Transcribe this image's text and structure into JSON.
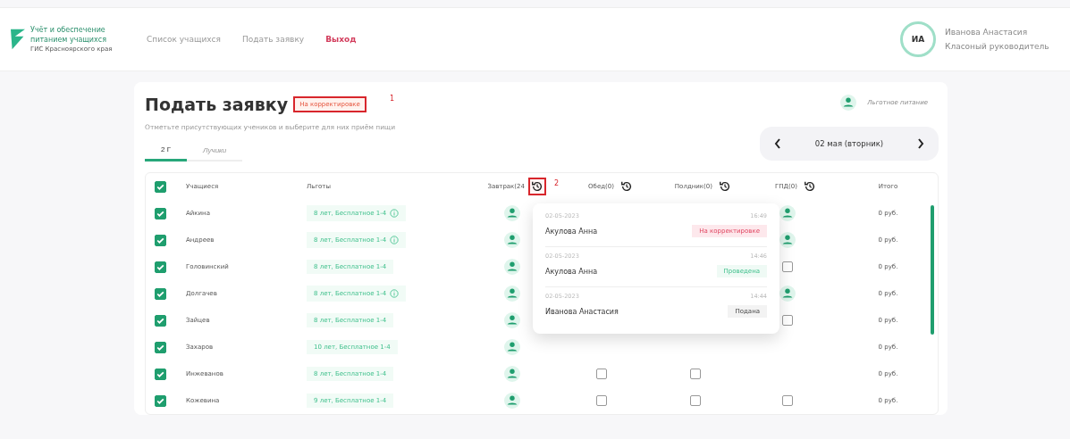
{
  "header": {
    "logo_lines": [
      "Учёт и обеспечение",
      "питанием учащихся",
      "ГИС Красноярского края"
    ],
    "nav": [
      {
        "label": "Список учащихся",
        "kind": "link"
      },
      {
        "label": "Подать заявку",
        "kind": "link"
      },
      {
        "label": "Выход",
        "kind": "logout"
      }
    ],
    "user": {
      "initials": "ИА",
      "name": "Иванова Анастасия",
      "role": "Класоный руководитель"
    }
  },
  "page": {
    "title": "Подать заявку",
    "badge": {
      "text": "На корректировке",
      "highlighted": true,
      "marker": "1"
    },
    "subtitle": "Отметьте присутствующих учеников и выберите для них приём пищи",
    "legend": "Льготное питание",
    "tabs": [
      {
        "label": "2 Г",
        "selected": true
      },
      {
        "label": "Лучики",
        "selected": false
      }
    ],
    "date": "02 мая (вторник)"
  },
  "table": {
    "all_checked": true,
    "columns": [
      {
        "label": "Учащиеся",
        "kind": "text"
      },
      {
        "label": "Льготы",
        "kind": "text"
      },
      {
        "label": "Завтрак(24",
        "kind": "meal",
        "highlighted": true,
        "marker": "2"
      },
      {
        "label": "Обед(0)",
        "kind": "meal",
        "highlighted": false
      },
      {
        "label": "Полдник(0)",
        "kind": "meal",
        "highlighted": false
      },
      {
        "label": "ГПД(0)",
        "kind": "meal",
        "highlighted": false
      },
      {
        "label": "Итого",
        "kind": "text"
      }
    ],
    "rows": [
      {
        "name": "Айкина",
        "checked": true,
        "benefit": "8 лет, Бесплатное 1-4",
        "info": true,
        "breakfast": {
          "kind": "benefit"
        },
        "gpd": {
          "kind": "benefit"
        },
        "total": "0 руб."
      },
      {
        "name": "Андреев",
        "checked": true,
        "benefit": "8 лет, Бесплатное 1-4",
        "info": true,
        "breakfast": {
          "kind": "benefit"
        },
        "gpd": {
          "kind": "benefit"
        },
        "total": "0 руб."
      },
      {
        "name": "Головинский",
        "checked": true,
        "benefit": "8 лет, Бесплатное 1-4",
        "info": false,
        "breakfast": {
          "kind": "benefit"
        },
        "gpd": {
          "kind": "checkbox",
          "checked": false
        },
        "total": "0 руб."
      },
      {
        "name": "Долгачев",
        "checked": true,
        "benefit": "8 лет, Бесплатное 1-4",
        "info": true,
        "breakfast": {
          "kind": "benefit"
        },
        "gpd": {
          "kind": "benefit"
        },
        "total": "0 руб."
      },
      {
        "name": "Зайцев",
        "checked": true,
        "benefit": "8 лет, Бесплатное 1-4",
        "info": false,
        "breakfast": {
          "kind": "benefit"
        },
        "gpd": {
          "kind": "checkbox",
          "checked": false
        },
        "total": "0 руб."
      },
      {
        "name": "Захаров",
        "checked": true,
        "benefit": "10 лет, Бесплатное 1-4",
        "info": false,
        "breakfast": {
          "kind": "benefit"
        },
        "total": "0 руб."
      },
      {
        "name": "Инжеванов",
        "checked": true,
        "benefit": "8 лет, Бесплатное 1-4",
        "info": false,
        "breakfast": {
          "kind": "benefit"
        },
        "lunch": {
          "kind": "checkbox",
          "checked": false
        },
        "snack": {
          "kind": "checkbox",
          "checked": false
        },
        "total": "0 руб."
      },
      {
        "name": "Кожевина",
        "checked": true,
        "benefit": "9 лет, Бесплатное 1-4",
        "info": false,
        "breakfast": {
          "kind": "benefit"
        },
        "lunch": {
          "kind": "checkbox",
          "checked": false
        },
        "snack": {
          "kind": "checkbox",
          "checked": false
        },
        "gpd": {
          "kind": "checkbox",
          "checked": false
        },
        "total": "0 руб."
      }
    ]
  },
  "history_popup": [
    {
      "date": "02-05-2023",
      "time": "16:49",
      "author": "Акулова Анна",
      "status": "На корректировке",
      "kind": "correction"
    },
    {
      "date": "02-05-2023",
      "time": "14:46",
      "author": "Акулова Анна",
      "status": "Проведена",
      "kind": "approved"
    },
    {
      "date": "02-05-2023",
      "time": "14:44",
      "author": "Иванова Анастасия",
      "status": "Подана",
      "kind": "submitted"
    }
  ]
}
